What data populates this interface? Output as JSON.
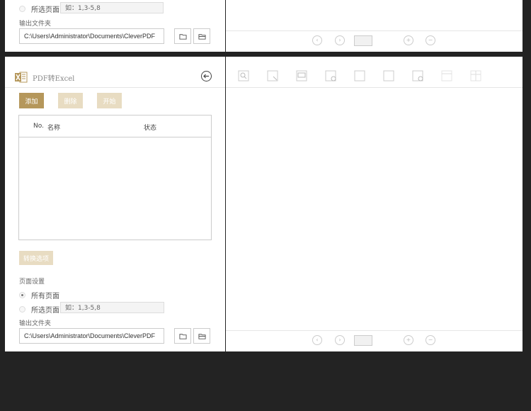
{
  "top_panel": {
    "selected_pages_label": "所选页面",
    "range_placeholder": "如：1,3-5,8",
    "output_folder_label": "输出文件夹",
    "output_path": "C:\\Users\\Administrator\\Documents\\CleverPDF"
  },
  "main": {
    "title": "PDF转Excel",
    "buttons": {
      "add": "添加",
      "delete": "删除",
      "start": "开始"
    },
    "table_headers": {
      "no": "No.",
      "name": "名称",
      "status": "状态"
    },
    "convert_options": "转换选项",
    "page_settings_label": "页面设置",
    "all_pages_label": "所有页面",
    "selected_pages_label": "所选页面",
    "range_placeholder": "如：1,3-5,8",
    "output_folder_label": "输出文件夹",
    "output_path": "C:\\Users\\Administrator\\Documents\\CleverPDF"
  },
  "icons": {
    "logo": "excel-logo-icon",
    "back": "back-arrow-icon",
    "folder": "folder-icon",
    "open_folder": "open-folder-icon"
  },
  "colors": {
    "accent": "#b5975b",
    "accent_disabled": "#e8dcc2",
    "background": "#232323"
  }
}
